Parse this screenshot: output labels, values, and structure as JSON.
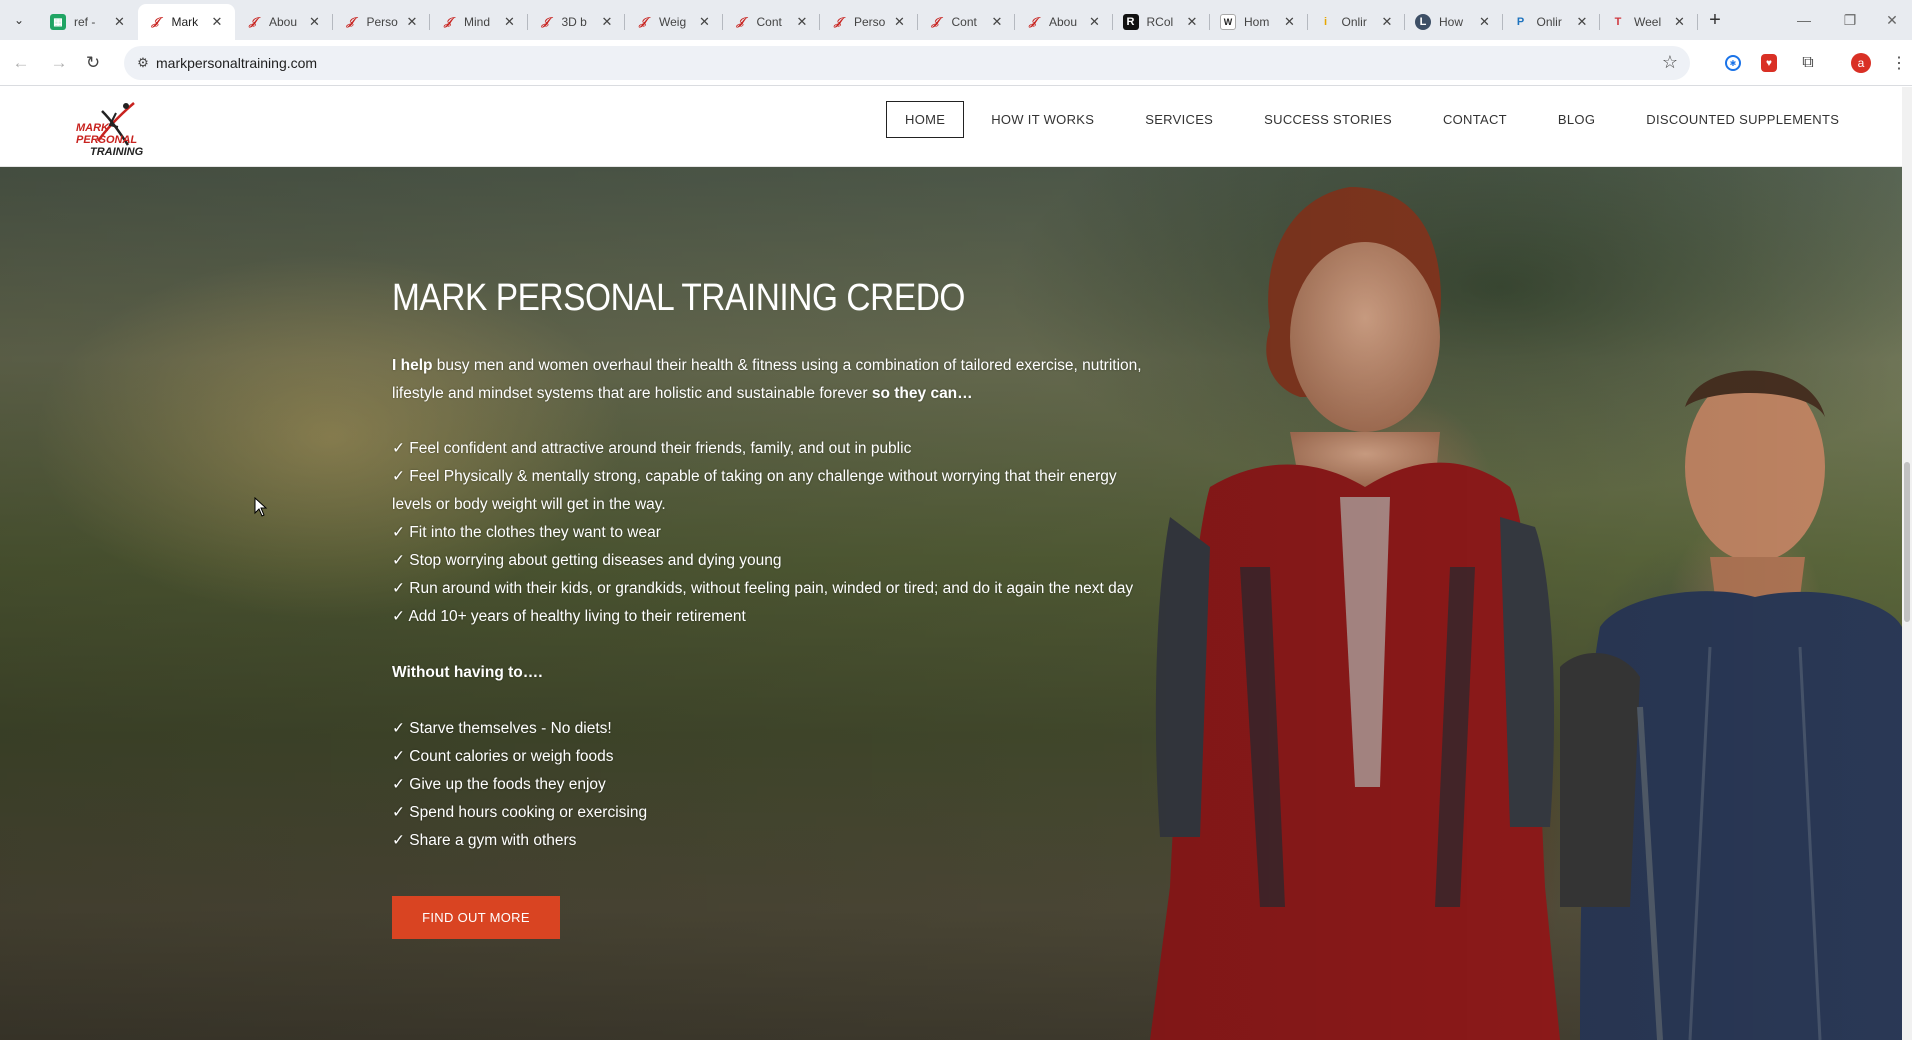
{
  "browser": {
    "tabs": [
      {
        "title": "ref -",
        "fav": "sheets-icon",
        "cls": "sheets",
        "glyph": "▦"
      },
      {
        "title": "Mark",
        "fav": "mark-icon",
        "cls": "mark",
        "glyph": "𝒥",
        "active": true
      },
      {
        "title": "Abou",
        "fav": "mark-icon",
        "cls": "mark",
        "glyph": "𝒥"
      },
      {
        "title": "Perso",
        "fav": "mark-icon",
        "cls": "mark",
        "glyph": "𝒥"
      },
      {
        "title": "Mind",
        "fav": "mark-icon",
        "cls": "mark",
        "glyph": "𝒥"
      },
      {
        "title": "3D b",
        "fav": "mark-icon",
        "cls": "mark",
        "glyph": "𝒥"
      },
      {
        "title": "Weig",
        "fav": "mark-icon",
        "cls": "mark",
        "glyph": "𝒥"
      },
      {
        "title": "Cont",
        "fav": "mark-icon",
        "cls": "mark",
        "glyph": "𝒥"
      },
      {
        "title": "Perso",
        "fav": "mark-icon",
        "cls": "mark",
        "glyph": "𝒥"
      },
      {
        "title": "Cont",
        "fav": "mark-icon",
        "cls": "mark",
        "glyph": "𝒥"
      },
      {
        "title": "Abou",
        "fav": "mark-icon",
        "cls": "mark",
        "glyph": "𝒥"
      },
      {
        "title": "RCol",
        "fav": "r-icon",
        "cls": "r",
        "glyph": "R"
      },
      {
        "title": "Hom",
        "fav": "w-icon",
        "cls": "w",
        "glyph": "W"
      },
      {
        "title": "Onlir",
        "fav": "o-icon",
        "cls": "o",
        "glyph": "i"
      },
      {
        "title": "How",
        "fav": "l-icon",
        "cls": "l",
        "glyph": "L"
      },
      {
        "title": "Onlir",
        "fav": "p-icon",
        "cls": "p",
        "glyph": "P"
      },
      {
        "title": "Weel",
        "fav": "t-icon",
        "cls": "t",
        "glyph": "T"
      }
    ],
    "url": "markpersonaltraining.com",
    "profile_initial": "a"
  },
  "site": {
    "logo": {
      "line1": "MARK PERSONAL",
      "line2": "TRAINING"
    },
    "menu": [
      "HOME",
      "HOW IT WORKS",
      "SERVICES",
      "SUCCESS STORIES",
      "CONTACT",
      "BLOG",
      "DISCOUNTED SUPPLEMENTS"
    ]
  },
  "hero": {
    "title": "MARK PERSONAL TRAINING CREDO",
    "intro_bold_start": "I help",
    "intro_mid": " busy men and women overhaul their health & fitness using a combination of tailored exercise, nutrition, lifestyle and mindset systems that are holistic and sustainable forever ",
    "intro_bold_end": "so they can…",
    "benefits": [
      "✓ Feel confident and attractive around their friends, family, and out in public",
      "✓ Feel Physically & mentally strong, capable of taking on any challenge without worrying that their energy",
      "levels or body weight will get in the way.",
      "✓ Fit into the clothes they want to wear",
      "✓ Stop worrying about getting diseases and dying young",
      "✓ Run around with their kids, or grandkids, without feeling pain, winded or tired; and do it again the next day",
      "✓ Add 10+ years of healthy living to their retirement"
    ],
    "without_heading": "Without having to….",
    "without_items": [
      "✓ Starve themselves - No diets!",
      "✓ Count calories or weigh foods",
      "✓ Give up the foods they enjoy",
      "✓ Spend hours cooking or exercising",
      "✓ Share a gym with others"
    ],
    "cta_label": "FIND OUT MORE"
  },
  "colors": {
    "accent": "#d94422",
    "brand_red": "#c8231f"
  }
}
